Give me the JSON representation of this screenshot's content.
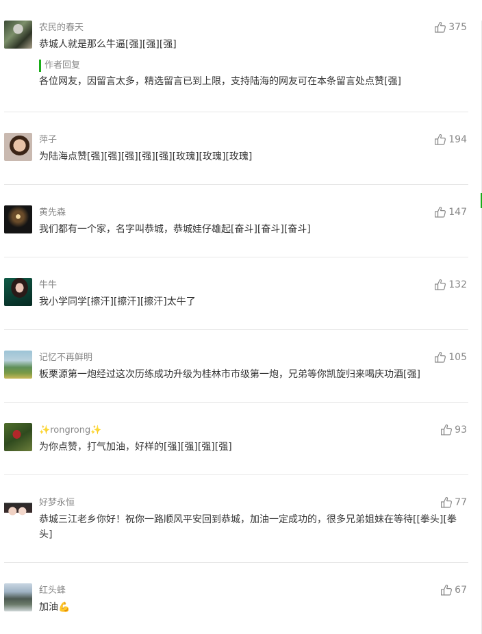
{
  "comments": [
    {
      "nickname": "农民的春天",
      "likes": "375",
      "text": "恭城人就是那么牛逼[强][强][强]",
      "author_reply_label": "作者回复",
      "author_reply_text": "各位网友，因留言太多，精选留言已到上限，支持陆海的网友可在本条留言处点赞[强]"
    },
    {
      "nickname": "萍子",
      "likes": "194",
      "text": "为陆海点赞[强][强][强][强][强][玫瑰][玫瑰][玫瑰]"
    },
    {
      "nickname": "黄先森",
      "likes": "147",
      "text": "我们都有一个家，名字叫恭城，恭城娃仔雄起[奋斗][奋斗][奋斗]"
    },
    {
      "nickname": "牛牛",
      "likes": "132",
      "text": "我小学同学[擦汗][擦汗][擦汗]太牛了"
    },
    {
      "nickname": "记忆不再鲜明",
      "likes": "105",
      "text": "板栗源第一炮经过这次历练成功升级为桂林市市级第一炮，兄弟等你凯旋归来喝庆功酒[强]"
    },
    {
      "nickname": "rongrong",
      "nickname_deco": "✨",
      "likes": "93",
      "text": "为你点赞，打气加油，好样的[强][强][强][强]"
    },
    {
      "nickname": "好梦永恒",
      "likes": "77",
      "text": "恭城三江老乡你好！祝你一路顺风平安回到恭城，加油一定成功的，很多兄弟姐妹在等待[[拳头][拳头]"
    },
    {
      "nickname": "红头蜂",
      "likes": "67",
      "text": "加油",
      "text_emoji": "💪"
    }
  ],
  "colors": {
    "accent": "#1aad19",
    "nickname": "#888888",
    "text": "#333333",
    "divider": "#e6e6e6"
  },
  "icons": {
    "like": "thumbs-up-outline-icon",
    "sparkle": "sparkle-icon"
  }
}
